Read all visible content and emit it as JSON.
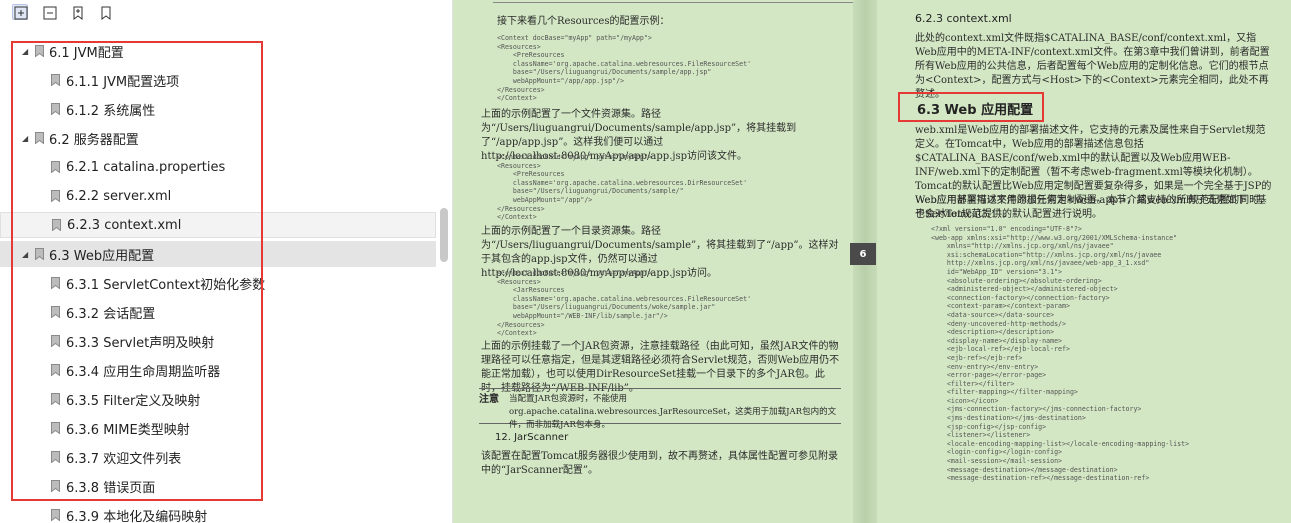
{
  "toolbar": {
    "icons": [
      "expand-all-icon",
      "collapse-all-icon",
      "add-bookmark-icon",
      "bookmark-icon"
    ]
  },
  "toc": [
    {
      "label": "6.1 JVM配置",
      "level": 1,
      "expanded": true
    },
    {
      "label": "6.1.1 JVM配置选项",
      "level": 2
    },
    {
      "label": "6.1.2 系统属性",
      "level": 2
    },
    {
      "label": "6.2 服务器配置",
      "level": 1,
      "expanded": true
    },
    {
      "label": "6.2.1 catalina.properties",
      "level": 2
    },
    {
      "label": "6.2.2 server.xml",
      "level": 2
    },
    {
      "label": "6.2.3 context.xml",
      "level": 2,
      "highlighted": true
    },
    {
      "label": "6.3 Web应用配置",
      "level": 1,
      "expanded": true,
      "selected": true
    },
    {
      "label": "6.3.1 ServletContext初始化参数",
      "level": 2
    },
    {
      "label": "6.3.2 会话配置",
      "level": 2
    },
    {
      "label": "6.3.3 Servlet声明及映射",
      "level": 2
    },
    {
      "label": "6.3.4 应用生命周期监听器",
      "level": 2
    },
    {
      "label": "6.3.5 Filter定义及映射",
      "level": 2
    },
    {
      "label": "6.3.6 MIME类型映射",
      "level": 2
    },
    {
      "label": "6.3.7 欢迎文件列表",
      "level": 2
    },
    {
      "label": "6.3.8 错误页面",
      "level": 2
    },
    {
      "label": "6.3.9 本地化及编码映射",
      "level": 2
    }
  ],
  "left_page": {
    "intro": "接下来看几个Resources的配置示例：",
    "code1": "<Context docBase=\"myApp\" path=\"/myApp\">\n<Resources>\n    <PreResources\n    className='org.apache.catalina.webresources.FileResourceSet'\n    base=\"/Users/liuguangrui/Documents/sample/app.jsp\"\n    webAppMount=\"/app/app.jsp\"/>\n</Resources>\n</Context>",
    "para1": "上面的示例配置了一个文件资源集。路径为“/Users/liuguangrui/Documents/sample/app.jsp”，将其挂载到了“/app/app.jsp”。这样我们便可以通过http://localhost:8080/myApp/app/app.jsp访问该文件。",
    "code2": "<Context docBase=\"myApp\" path=\"/myApp\">\n<Resources>\n    <PreResources\n    className='org.apache.catalina.webresources.DirResourceSet'\n    base=\"/Users/liuguangrui/Documents/sample/\"\n    webAppMount=\"/app\"/>\n</Resources>\n</Context>",
    "para2": "上面的示例配置了一个目录资源集。路径为“/Users/liuguangrui/Documents/sample”，将其挂载到了“/app”。这样对于其包含的app.jsp文件，仍然可以通过http://localhost:8080/myApp/app/app.jsp访问。",
    "code3": "<Context docBase=\"myApp\" path=\"/myApp\">\n<Resources>\n    <JarResources\n    className='org.apache.catalina.webresources.FileResourceSet'\n    base=\"/Users/liuguangrui/Documents/woke/sample.jar\"\n    webAppMount=\"/WEB-INF/lib/sample.jar\"/>\n</Resources>\n</Context>",
    "para3": "上面的示例挂载了一个JAR包资源，注意挂载路径（由此可知，虽然JAR文件的物理路径可以任意指定，但是其逻辑路径必须符合Servlet规范，否则Web应用仍不能正常加载），也可以使用DirResourceSet挂载一个目录下的多个JAR包。此时，挂载路径为“/WEB-INF/lib”。",
    "note_label": "注意",
    "note_text": "当配置JAR包资源时，不能使用org.apache.catalina.webresources.JarResourceSet，这类用于加载JAR包内的文件，而非加载JAR包本身。",
    "heading_12": "12. JarScanner",
    "para4": "该配置在配置Tomcat服务器很少使用到，故不再赘述，具体属性配置可参见附录中的“JarScanner配置”。"
  },
  "right_page": {
    "heading_623": "6.2.3   context.xml",
    "para1": "此处的context.xml文件既指$CATALINA_BASE/conf/context.xml，又指Web应用中的META-INF/context.xml文件。在第3章中我们曾讲到，前者配置所有Web应用的公共信息，后者配置每个Web应用的定制化信息。它们的根节点为<Context>，配置方式与<Host>下的<Context>元素完全相同，此处不再赘述。",
    "heading_63": "6.3   Web 应用配置",
    "para2": "web.xml是Web应用的部署描述文件，它支持的元素及属性来自于Servlet规范定义。在Tomcat中，Web应用的部署描述信息包括$CATALINA_BASE/conf/web.xml中的默认配置以及Web应用WEB-INF/web.xml下的定制配置（暂不考虑web-fragment.xml等模块化机制）。Tomcat的默认配置比Web应用定制配置要复杂得多，如果是一个完全基于JSP的Web应用甚至可以不用添加任何定制配置。本节介绍web.xml规范配置的同时，也会对Tomcat提供的默认配置进行说明。",
    "para3": "Web应用部署描述文件的根元素为<web-app>，其支持的所有子元素如下（基于Servlet规范3.1）。",
    "code": "<?xml version=\"1.0\" encoding=\"UTF-8\"?>\n<web-app xmlns:xsi=\"http://www.w3.org/2001/XMLSchema-instance\"\n    xmlns=\"http://xmlns.jcp.org/xml/ns/javaee\"\n    xsi:schemaLocation=\"http://xmlns.jcp.org/xml/ns/javaee\n    http://xmlns.jcp.org/xml/ns/javaee/web-app_3_1.xsd\"\n    id=\"WebApp_ID\" version=\"3.1\">\n    <absolute-ordering></absolute-ordering>\n    <administered-object></administered-object>\n    <connection-factory></connection-factory>\n    <context-param></context-param>\n    <data-source></data-source>\n    <deny-uncovered-http-methods/>\n    <description></description>\n    <display-name></display-name>\n    <ejb-local-ref></ejb-local-ref>\n    <ejb-ref></ejb-ref>\n    <env-entry></env-entry>\n    <error-page></error-page>\n    <filter></filter>\n    <filter-mapping></filter-mapping>\n    <icon></icon>\n    <jms-connection-factory></jms-connection-factory>\n    <jms-destination></jms-destination>\n    <jsp-config></jsp-config>\n    <listener></listener>\n    <locale-encoding-mapping-list></locale-encoding-mapping-list>\n    <login-config></login-config>\n    <mail-session></mail-session>\n    <message-destination></message-destination>\n    <message-destination-ref></message-destination-ref>"
  },
  "page_tab": "6",
  "colors": {
    "highlight_box": "#e53935",
    "page_bg": "#d3e7c4"
  }
}
